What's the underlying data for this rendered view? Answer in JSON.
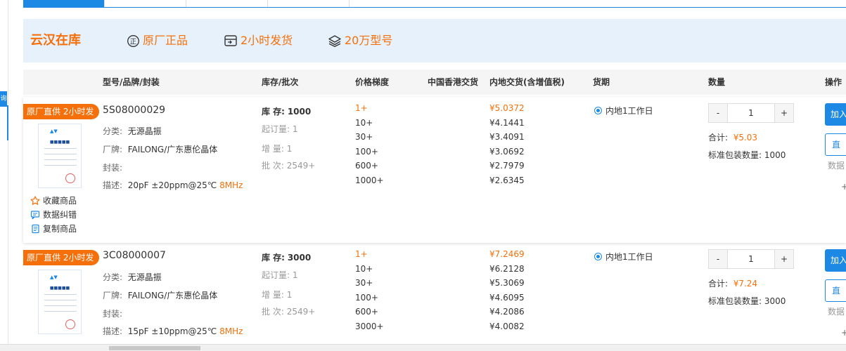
{
  "sidebar_tag": "询",
  "banner": {
    "title": "云汉在库",
    "features": [
      {
        "label": "原厂正品",
        "icon": "genuine-seal-icon"
      },
      {
        "label": "2小时发货",
        "icon": "shipping-box-icon"
      },
      {
        "label": "20万型号",
        "icon": "layers-icon"
      }
    ],
    "accent": "#f5700a",
    "background": "#e6f1fc"
  },
  "columns": {
    "model": "型号/品牌/封装",
    "stock": "库存/批次",
    "tiers": "价格梯度",
    "hk": "中国香港交货",
    "cn": "内地交货(含增值税)",
    "lead": "货期",
    "qty": "数量",
    "ops": "操作"
  },
  "labels": {
    "category": "分类:",
    "brand": "厂牌:",
    "package": "封装:",
    "desc": "描述:",
    "stock": "库 存:",
    "moq": "起订量:",
    "incr": "增 量:",
    "batch": "批 次:",
    "total": "合计:",
    "std_pack": "标准包装数量:",
    "add": "加入",
    "direct": "直",
    "data": "数据",
    "plus": "+",
    "fav": "收藏商品",
    "error": "数据纠错",
    "copy": "复制商品",
    "minus": "-",
    "inc": "+"
  },
  "products": [
    {
      "badge": "原厂直供 2小时发",
      "model": "5S08000029",
      "category": "无源晶振",
      "brand": "FAILONG/广东惠伦晶体",
      "package": "",
      "desc_main": "20pF ±20ppm@25℃ ",
      "desc_hl": "8MHz",
      "stock": "1000",
      "moq": "1",
      "incr": "1",
      "batch": "2549+",
      "tiers": [
        "1+",
        "10+",
        "30+",
        "100+",
        "600+",
        "1000+"
      ],
      "prices": [
        "¥5.0372",
        "¥4.1441",
        "¥3.4091",
        "¥3.0692",
        "¥2.7979",
        "¥2.6345"
      ],
      "lead": "内地1工作日",
      "qty": "1",
      "total": "¥5.03",
      "std_pack": "1000"
    },
    {
      "badge": "原厂直供 2小时发",
      "model": "3C08000007",
      "category": "无源晶振",
      "brand": "FAILONG/广东惠伦晶体",
      "package": "",
      "desc_main": "15pF ±10ppm@25℃ ",
      "desc_hl": "8MHz",
      "stock": "3000",
      "moq": "1",
      "incr": "1",
      "batch": "2549+",
      "tiers": [
        "1+",
        "10+",
        "30+",
        "100+",
        "600+",
        "3000+"
      ],
      "prices": [
        "¥7.2469",
        "¥6.2128",
        "¥5.3069",
        "¥4.6095",
        "¥4.2086",
        "¥4.0082"
      ],
      "lead": "内地1工作日",
      "qty": "1",
      "total": "¥7.24",
      "std_pack": "3000"
    }
  ]
}
